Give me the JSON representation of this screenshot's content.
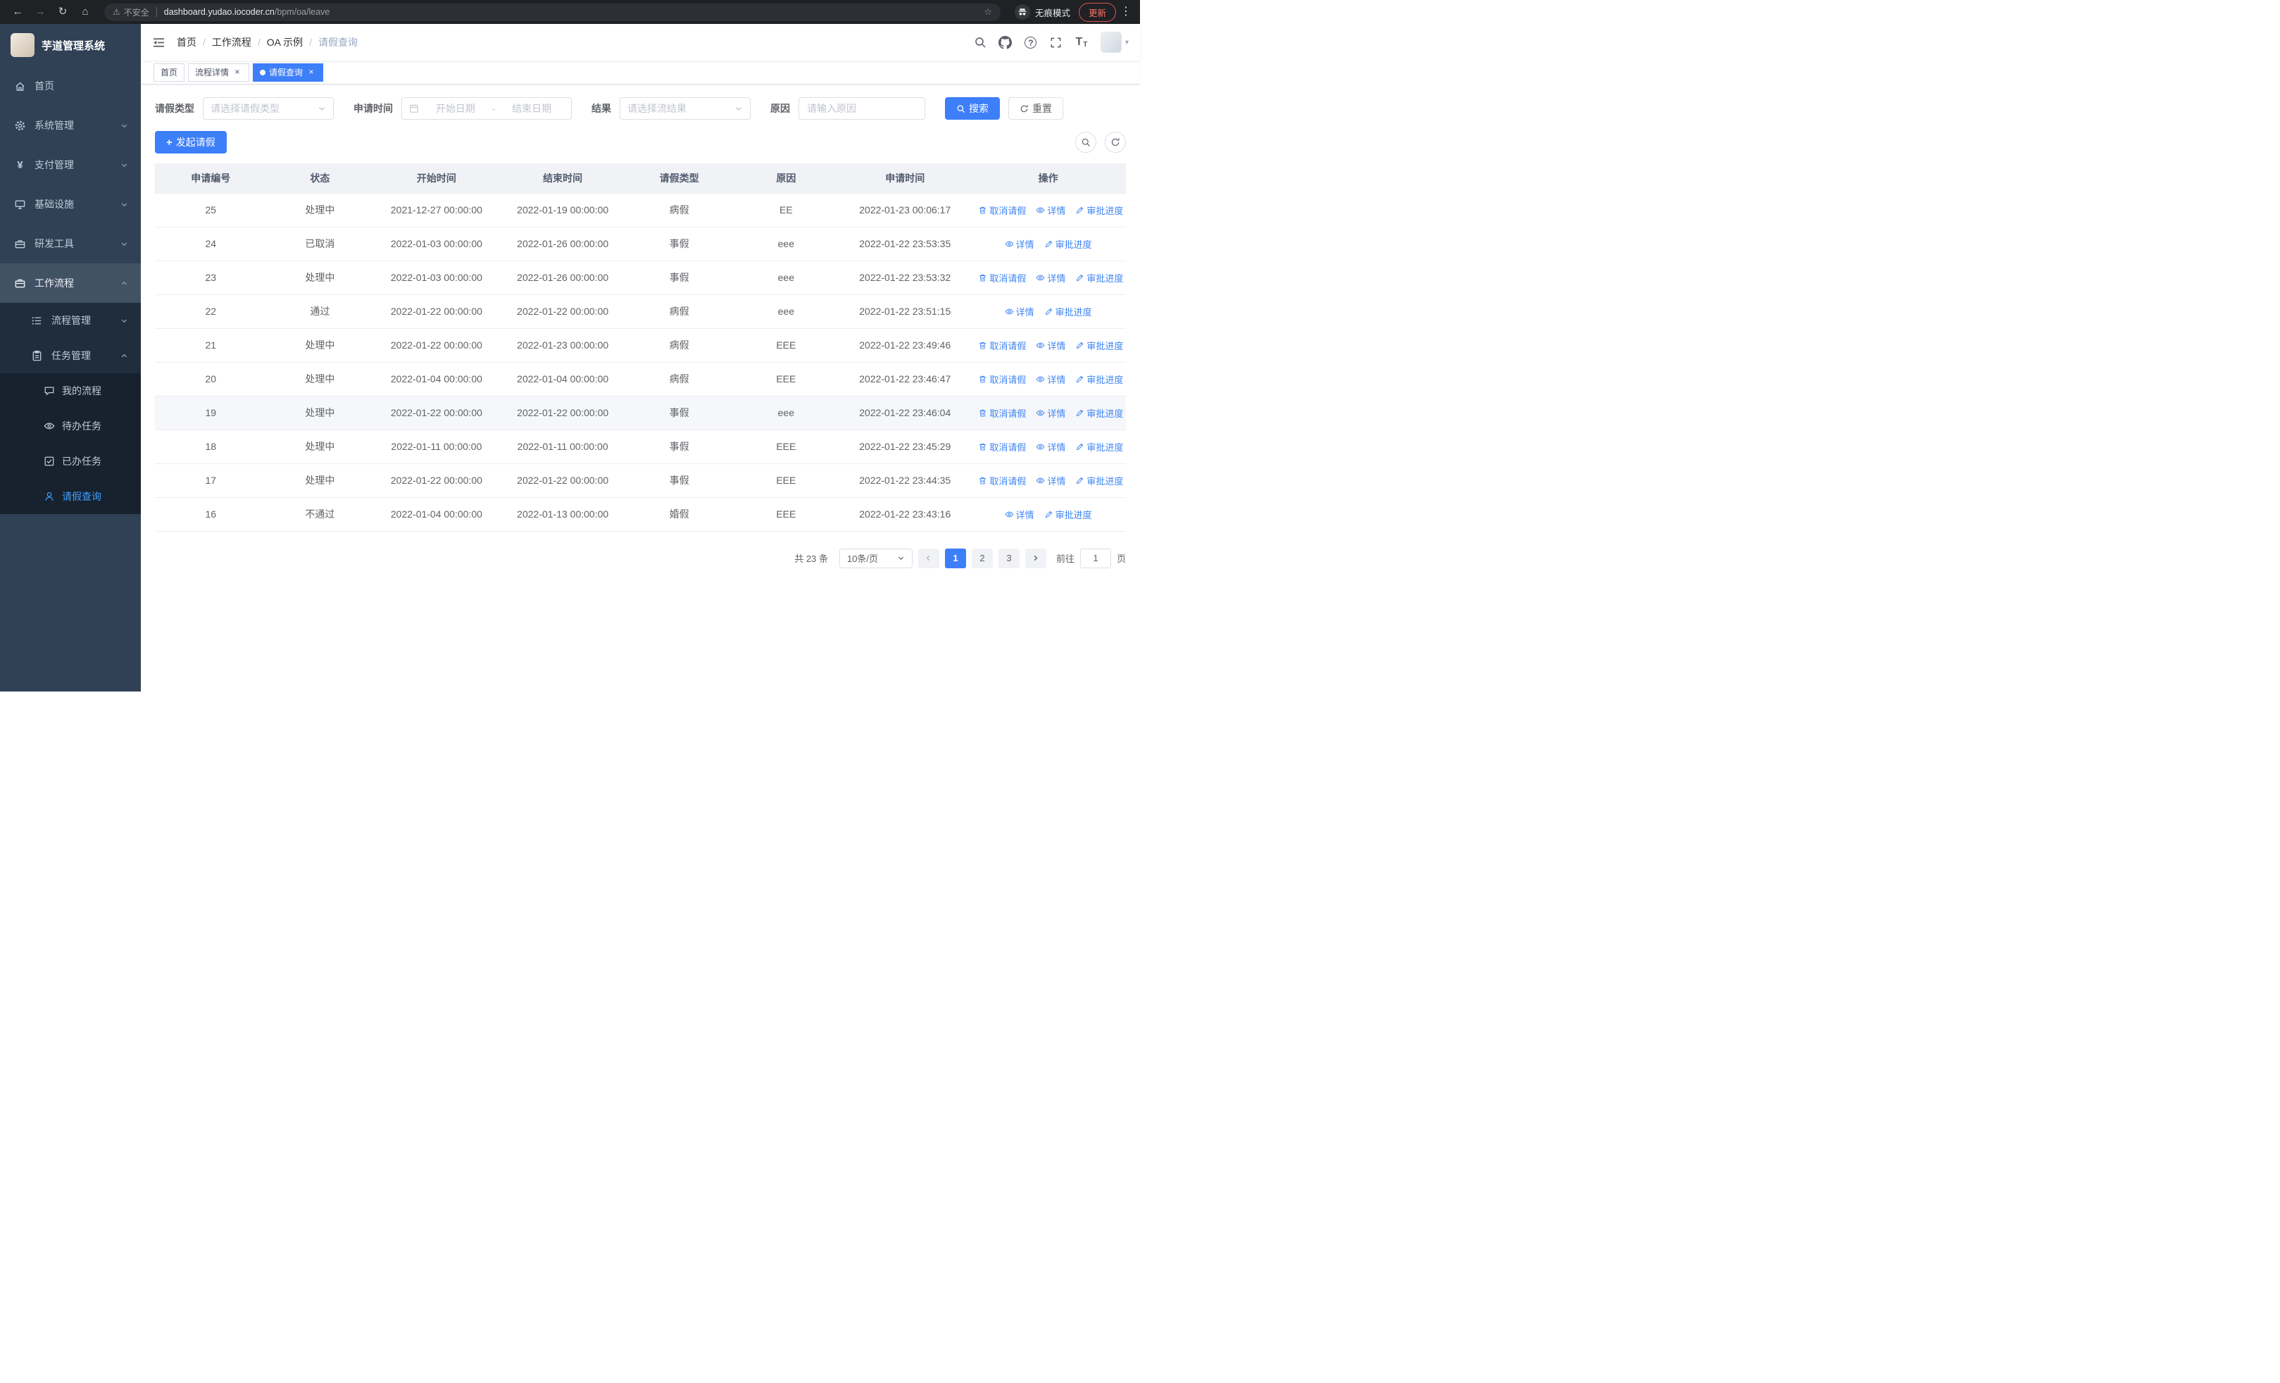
{
  "browser": {
    "security_label": "不安全",
    "url_host": "dashboard.yudao.iocoder.cn",
    "url_path": "/bpm/oa/leave",
    "incognito_label": "无痕模式",
    "update_label": "更新"
  },
  "icons": {
    "back": "←",
    "forward": "→",
    "reload": "↻",
    "home": "⌂",
    "warning": "⚠",
    "star": "☆",
    "menu_dots": "⋮",
    "yen": "¥",
    "caret_down": "▾",
    "question": "?",
    "plus": "+",
    "close": "×",
    "slash": "/",
    "font_large": "T",
    "font_small": "T"
  },
  "sidebar": {
    "title": "芋道管理系统",
    "items": [
      {
        "label": "首页"
      },
      {
        "label": "系统管理"
      },
      {
        "label": "支付管理"
      },
      {
        "label": "基础设施"
      },
      {
        "label": "研发工具"
      },
      {
        "label": "工作流程",
        "open": true
      },
      {
        "label": "流程管理"
      },
      {
        "label": "任务管理",
        "open": true
      },
      {
        "label": "我的流程"
      },
      {
        "label": "待办任务"
      },
      {
        "label": "已办任务"
      },
      {
        "label": "请假查询",
        "active": true
      }
    ]
  },
  "breadcrumb": {
    "items": [
      "首页",
      "工作流程",
      "OA 示例",
      "请假查询"
    ]
  },
  "tabs": [
    {
      "label": "首页",
      "closable": false,
      "active": false
    },
    {
      "label": "流程详情",
      "closable": true,
      "active": false
    },
    {
      "label": "请假查询",
      "closable": true,
      "active": true
    }
  ],
  "filters": {
    "leave_type_label": "请假类型",
    "leave_type_placeholder": "请选择请假类型",
    "apply_time_label": "申请时间",
    "start_date_placeholder": "开始日期",
    "date_separator": "-",
    "end_date_placeholder": "结束日期",
    "result_label": "结果",
    "result_placeholder": "请选择流结果",
    "reason_label": "原因",
    "reason_placeholder": "请输入原因",
    "search_label": "搜索",
    "reset_label": "重置"
  },
  "toolbar": {
    "create_label": "发起请假"
  },
  "table": {
    "headers": [
      "申请编号",
      "状态",
      "开始时间",
      "结束时间",
      "请假类型",
      "原因",
      "申请时间",
      "操作"
    ],
    "action_labels": {
      "cancel": "取消请假",
      "detail": "详情",
      "progress": "审批进度"
    },
    "rows": [
      {
        "id": "25",
        "status": "处理中",
        "start": "2021-12-27 00:00:00",
        "end": "2022-01-19 00:00:00",
        "type": "病假",
        "reason": "EE",
        "applied": "2022-01-23 00:06:17",
        "actions": [
          "cancel",
          "detail",
          "progress"
        ],
        "highlight": false
      },
      {
        "id": "24",
        "status": "已取消",
        "start": "2022-01-03 00:00:00",
        "end": "2022-01-26 00:00:00",
        "type": "事假",
        "reason": "eee",
        "applied": "2022-01-22 23:53:35",
        "actions": [
          "detail",
          "progress"
        ],
        "highlight": false
      },
      {
        "id": "23",
        "status": "处理中",
        "start": "2022-01-03 00:00:00",
        "end": "2022-01-26 00:00:00",
        "type": "事假",
        "reason": "eee",
        "applied": "2022-01-22 23:53:32",
        "actions": [
          "cancel",
          "detail",
          "progress"
        ],
        "highlight": false
      },
      {
        "id": "22",
        "status": "通过",
        "start": "2022-01-22 00:00:00",
        "end": "2022-01-22 00:00:00",
        "type": "病假",
        "reason": "eee",
        "applied": "2022-01-22 23:51:15",
        "actions": [
          "detail",
          "progress"
        ],
        "highlight": false
      },
      {
        "id": "21",
        "status": "处理中",
        "start": "2022-01-22 00:00:00",
        "end": "2022-01-23 00:00:00",
        "type": "病假",
        "reason": "EEE",
        "applied": "2022-01-22 23:49:46",
        "actions": [
          "cancel",
          "detail",
          "progress"
        ],
        "highlight": false
      },
      {
        "id": "20",
        "status": "处理中",
        "start": "2022-01-04 00:00:00",
        "end": "2022-01-04 00:00:00",
        "type": "病假",
        "reason": "EEE",
        "applied": "2022-01-22 23:46:47",
        "actions": [
          "cancel",
          "detail",
          "progress"
        ],
        "highlight": false
      },
      {
        "id": "19",
        "status": "处理中",
        "start": "2022-01-22 00:00:00",
        "end": "2022-01-22 00:00:00",
        "type": "事假",
        "reason": "eee",
        "applied": "2022-01-22 23:46:04",
        "actions": [
          "cancel",
          "detail",
          "progress"
        ],
        "highlight": true
      },
      {
        "id": "18",
        "status": "处理中",
        "start": "2022-01-11 00:00:00",
        "end": "2022-01-11 00:00:00",
        "type": "事假",
        "reason": "EEE",
        "applied": "2022-01-22 23:45:29",
        "actions": [
          "cancel",
          "detail",
          "progress"
        ],
        "highlight": false
      },
      {
        "id": "17",
        "status": "处理中",
        "start": "2022-01-22 00:00:00",
        "end": "2022-01-22 00:00:00",
        "type": "事假",
        "reason": "EEE",
        "applied": "2022-01-22 23:44:35",
        "actions": [
          "cancel",
          "detail",
          "progress"
        ],
        "highlight": false
      },
      {
        "id": "16",
        "status": "不通过",
        "start": "2022-01-04 00:00:00",
        "end": "2022-01-13 00:00:00",
        "type": "婚假",
        "reason": "EEE",
        "applied": "2022-01-22 23:43:16",
        "actions": [
          "detail",
          "progress"
        ],
        "highlight": false
      }
    ]
  },
  "pagination": {
    "total": "共 23 条",
    "page_size": "10条/页",
    "pages": [
      "1",
      "2",
      "3"
    ],
    "active": "1",
    "goto_label": "前往",
    "goto_value": "1",
    "goto_unit": "页"
  }
}
